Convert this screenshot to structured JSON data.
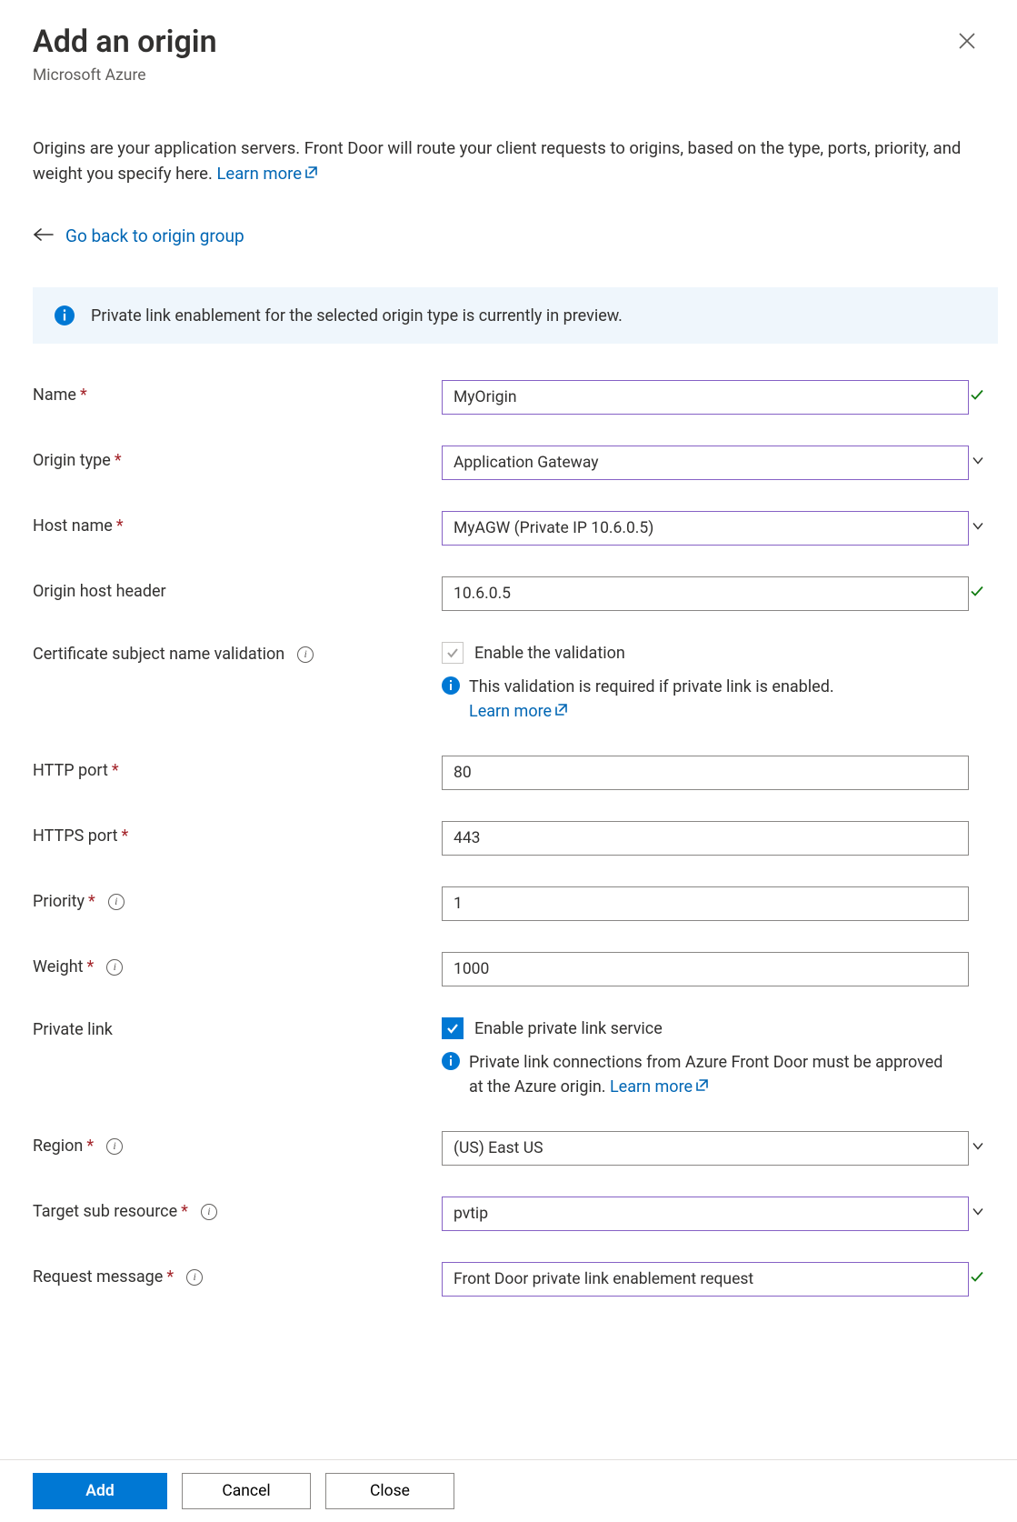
{
  "header": {
    "title": "Add an origin",
    "subtitle": "Microsoft Azure"
  },
  "description": {
    "text": "Origins are your application servers. Front Door will route your client requests to origins, based on the type, ports, priority, and weight you specify here. ",
    "learn_more": "Learn more"
  },
  "back_link": "Go back to origin group",
  "banner": {
    "text": "Private link enablement for the selected origin type is currently in preview."
  },
  "fields": {
    "name": {
      "label": "Name",
      "value": "MyOrigin"
    },
    "origin_type": {
      "label": "Origin type",
      "value": "Application Gateway"
    },
    "host_name": {
      "label": "Host name",
      "value": "MyAGW (Private IP 10.6.0.5)"
    },
    "host_header": {
      "label": "Origin host header",
      "value": "10.6.0.5"
    },
    "cert_validation": {
      "label": "Certificate subject name validation",
      "checkbox_label": "Enable the validation",
      "help": "This validation is required if private link is enabled. ",
      "learn_more": "Learn more"
    },
    "http_port": {
      "label": "HTTP port",
      "value": "80"
    },
    "https_port": {
      "label": "HTTPS port",
      "value": "443"
    },
    "priority": {
      "label": "Priority",
      "value": "1"
    },
    "weight": {
      "label": "Weight",
      "value": "1000"
    },
    "private_link": {
      "label": "Private link",
      "checkbox_label": "Enable private link service",
      "help": "Private link connections from Azure Front Door must be approved at the Azure origin. ",
      "learn_more": "Learn more"
    },
    "region": {
      "label": "Region",
      "value": "(US) East US"
    },
    "target_sub": {
      "label": "Target sub resource",
      "value": "pvtip"
    },
    "request_msg": {
      "label": "Request message",
      "value": "Front Door private link enablement request"
    }
  },
  "buttons": {
    "add": "Add",
    "cancel": "Cancel",
    "close": "Close"
  }
}
